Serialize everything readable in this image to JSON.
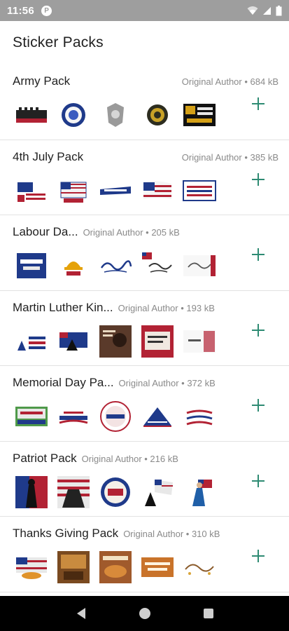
{
  "status_bar": {
    "time": "11:56",
    "badge": "P"
  },
  "header": {
    "title": "Sticker Packs"
  },
  "packs": [
    {
      "name": "Army Pack",
      "author": "Original Author",
      "size": "684 kB",
      "meta": "Original Author • 684 kB"
    },
    {
      "name": "4th July Pack",
      "author": "Original Author",
      "size": "385 kB",
      "meta": "Original Author • 385 kB"
    },
    {
      "name": "Labour Da...",
      "author": "Original Author",
      "size": "205 kB",
      "meta": "Original Author • 205 kB"
    },
    {
      "name": "Martin Luther Kin...",
      "author": "Original Author",
      "size": "193 kB",
      "meta": "Original Author • 193 kB"
    },
    {
      "name": "Memorial Day Pa...",
      "author": "Original Author",
      "size": "372 kB",
      "meta": "Original Author • 372 kB"
    },
    {
      "name": "Patriot Pack",
      "author": "Original Author",
      "size": "216 kB",
      "meta": "Original Author • 216 kB"
    },
    {
      "name": "Thanks Giving Pack",
      "author": "Original Author",
      "size": "310 kB",
      "meta": "Original Author • 310 kB"
    }
  ],
  "colors": {
    "accent": "#2e8b73",
    "status_bar": "#9e9e9e",
    "nav_bar": "#000000",
    "divider": "#e2e2e2"
  },
  "icons": [
    "wifi-icon",
    "signal-icon",
    "battery-icon",
    "add-icon",
    "back-icon",
    "home-icon",
    "recents-icon"
  ]
}
